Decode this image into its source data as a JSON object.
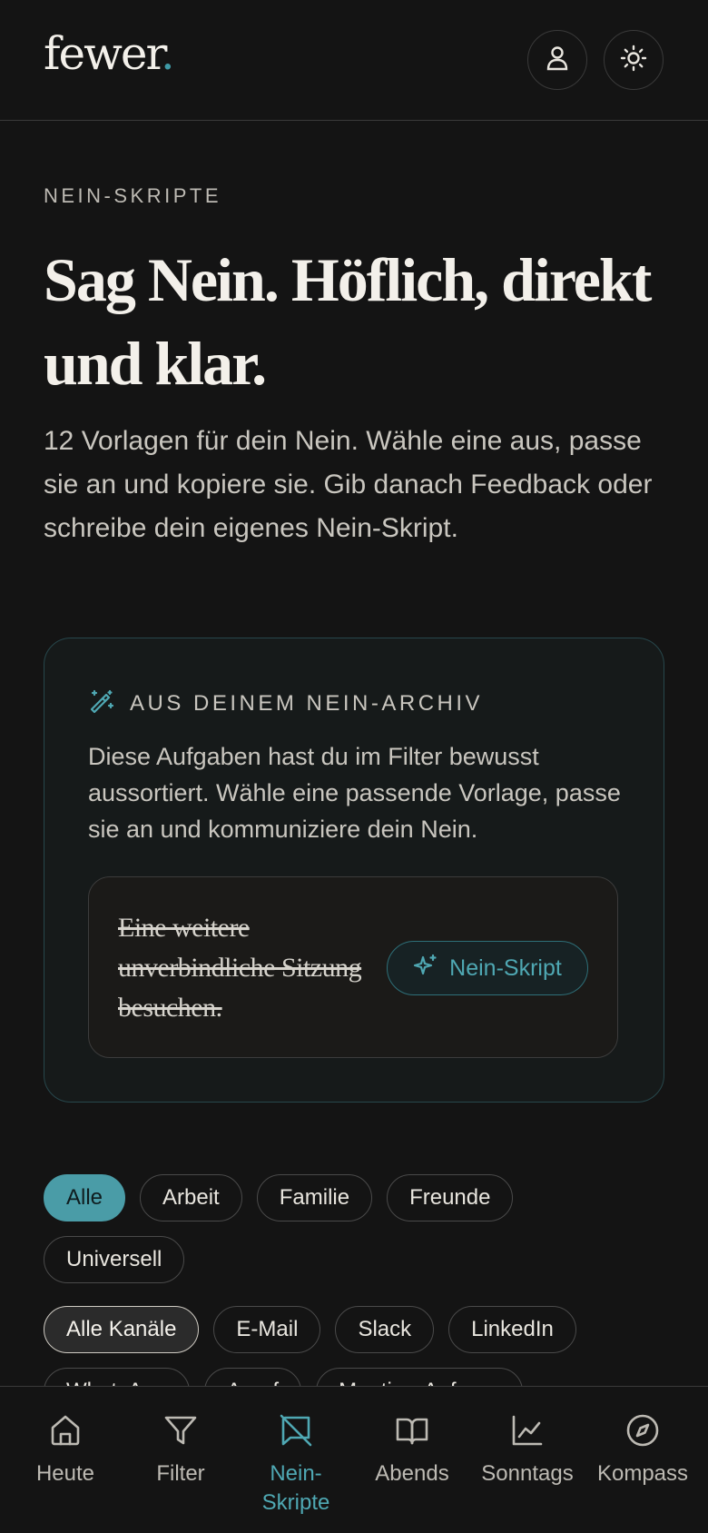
{
  "header": {
    "logo_text": "fewer",
    "logo_dot": ".",
    "user_icon": "user-icon",
    "theme_icon": "sun-icon"
  },
  "intro": {
    "eyebrow": "NEIN-SKRIPTE",
    "title": "Sag Nein. Höflich, direkt und klar.",
    "lead": "12 Vorlagen für dein Nein. Wähle eine aus, passe sie an und kopiere sie. Gib danach Feedback oder schreibe dein eigenes Nein-Skript."
  },
  "archive": {
    "icon": "magic-wand-icon",
    "label": "AUS DEINEM NEIN-ARCHIV",
    "description": "Diese Aufgaben hast du im Filter bewusst aussortiert. Wähle eine passende Vorlage, passe sie an und kommuniziere dein Nein.",
    "task": {
      "text": "Eine weitere unverbindliche Sitzung besuchen.",
      "button_label": "Nein-Skript",
      "button_icon": "sparkle-icon"
    }
  },
  "category_filters": [
    {
      "label": "Alle",
      "active": true
    },
    {
      "label": "Arbeit",
      "active": false
    },
    {
      "label": "Familie",
      "active": false
    },
    {
      "label": "Freunde",
      "active": false
    },
    {
      "label": "Universell",
      "active": false
    }
  ],
  "channel_filters": [
    {
      "label": "Alle Kanäle",
      "active": true
    },
    {
      "label": "E-Mail",
      "active": false
    },
    {
      "label": "Slack",
      "active": false
    },
    {
      "label": "LinkedIn",
      "active": false
    },
    {
      "label": "WhatsApp",
      "active": false
    },
    {
      "label": "Anruf",
      "active": false
    },
    {
      "label": "Meeting-Anfrage",
      "active": false
    }
  ],
  "nav": [
    {
      "label": "Heute",
      "icon": "home-icon",
      "active": false
    },
    {
      "label": "Filter",
      "icon": "filter-icon",
      "active": false
    },
    {
      "label": "Nein-Skripte",
      "icon": "no-message-icon",
      "active": true
    },
    {
      "label": "Abends",
      "icon": "book-icon",
      "active": false
    },
    {
      "label": "Sonntags",
      "icon": "chart-icon",
      "active": false
    },
    {
      "label": "Kompass",
      "icon": "compass-icon",
      "active": false
    }
  ],
  "colors": {
    "background": "#141414",
    "accent": "#4a9ca7",
    "text": "#e9e6df"
  }
}
